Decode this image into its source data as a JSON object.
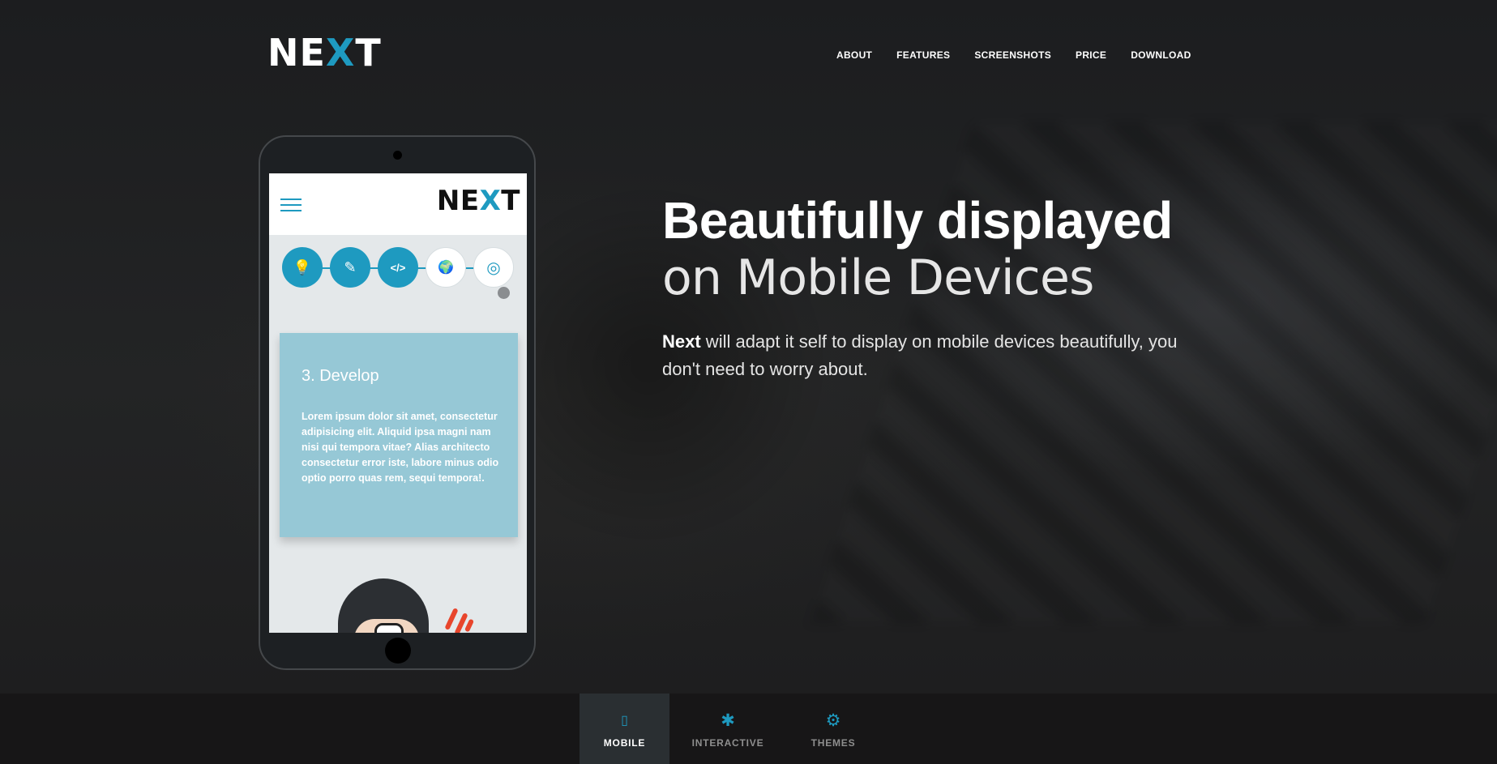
{
  "brand": {
    "logo_pre": "NE",
    "logo_x": "X",
    "logo_post": "T",
    "accent": "#1e9ac0"
  },
  "nav": {
    "items": [
      "ABOUT",
      "FEATURES",
      "SCREENSHOTS",
      "PRICE",
      "DOWNLOAD"
    ]
  },
  "hero": {
    "headline_line1": "Beautifully displayed",
    "headline_line2": "on Mobile Devices",
    "desc_bold": "Next",
    "desc_rest": " will adapt it self to display on mobile devices beautifully, you don't need to worry about."
  },
  "phone": {
    "logo_pre": "NE",
    "logo_x": "X",
    "logo_post": "T",
    "steps": [
      {
        "icon": "lightbulb-icon",
        "glyph": "💡",
        "active": true
      },
      {
        "icon": "edit-icon",
        "glyph": "✎",
        "active": true
      },
      {
        "icon": "code-icon",
        "glyph": "</>",
        "active": true
      },
      {
        "icon": "globe-icon",
        "glyph": "🌍",
        "active": false
      },
      {
        "icon": "lifebuoy-icon",
        "glyph": "◎",
        "active": false
      }
    ],
    "card_title": "3. Develop",
    "card_text": "Lorem ipsum dolor sit amet, consectetur adipisicing elit. Aliquid ipsa magni nam nisi qui tempora vitae? Alias architecto consectetur error iste, labore minus odio optio porro quas rem, sequi tempora!."
  },
  "tabs": [
    {
      "label": "MOBILE",
      "icon": "mobile-icon",
      "glyph": "▯",
      "selected": true
    },
    {
      "label": "INTERACTIVE",
      "icon": "asterisk-icon",
      "glyph": "✱",
      "selected": false
    },
    {
      "label": "THEMES",
      "icon": "gear-icon",
      "glyph": "⚙",
      "selected": false
    }
  ]
}
